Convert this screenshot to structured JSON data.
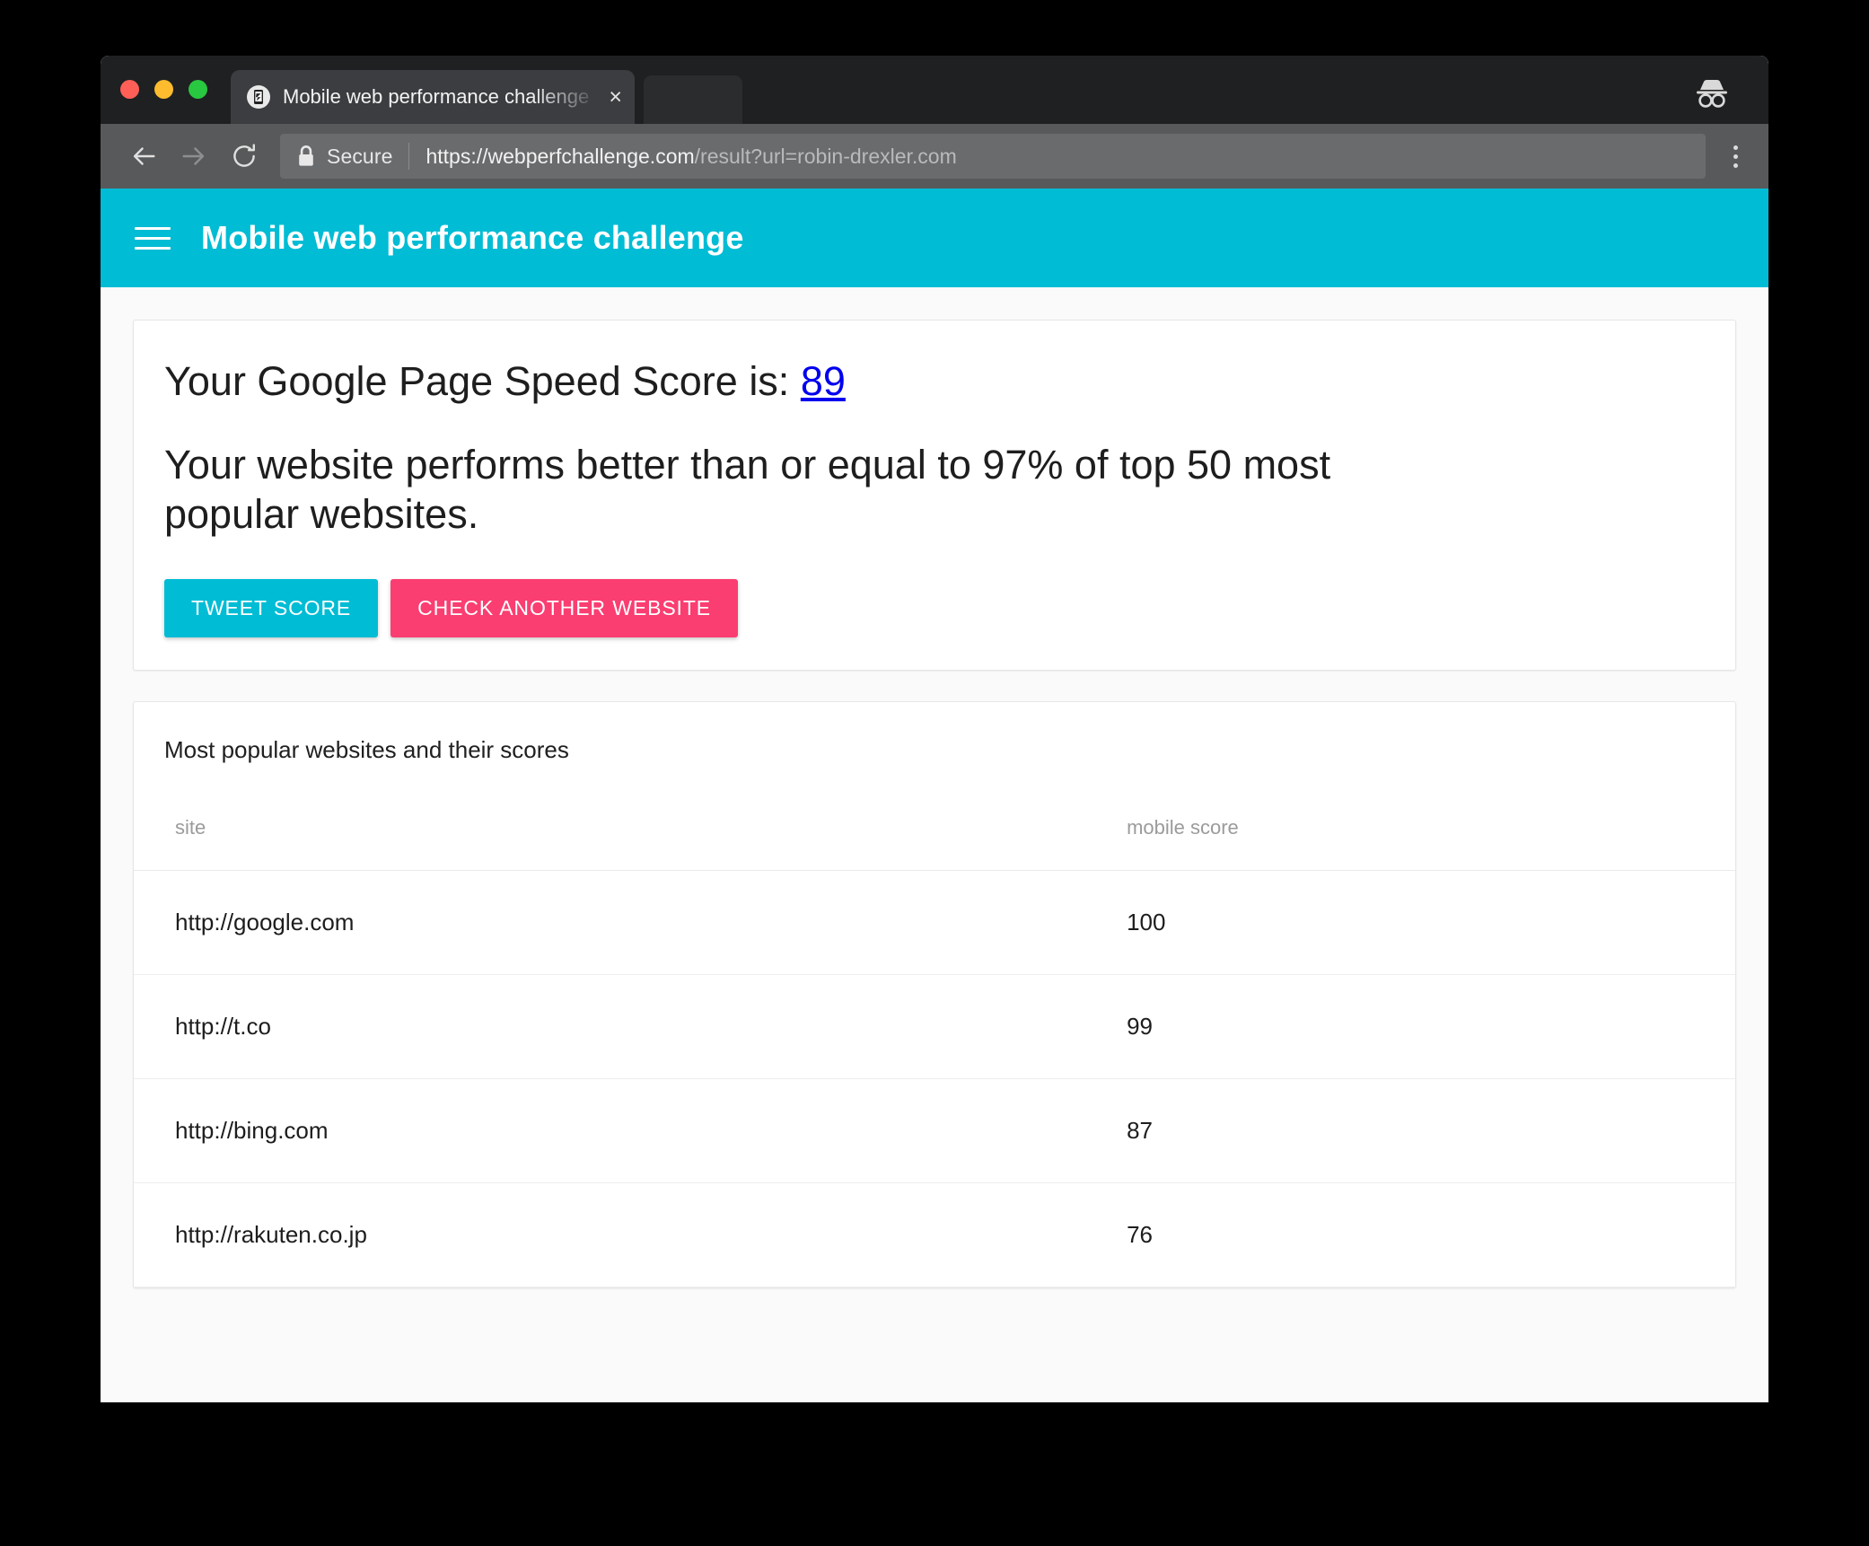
{
  "browser": {
    "tab": {
      "title": "Mobile web performance challenge",
      "close_label": "×",
      "favicon_name": "site-favicon"
    },
    "toolbar": {
      "back_label": "←",
      "forward_label": "→",
      "reload_label": "↻",
      "security_label": "Secure",
      "url_scheme_host": "https://webperfchallenge.com",
      "url_path": "/result?url=robin-drexler.com",
      "menu_label": "⋮"
    },
    "incognito_label": "incognito-icon"
  },
  "app": {
    "menu_label": "☰",
    "title": "Mobile web performance challenge",
    "accent_color": "#00bcd4"
  },
  "result": {
    "heading_prefix": "Your Google Page Speed Score is: ",
    "score": "89",
    "description": "Your website performs better than or equal to 97% of top 50 most popular websites.",
    "buttons": {
      "tweet": "TWEET SCORE",
      "check_another": "CHECK ANOTHER WEBSITE"
    },
    "button_colors": {
      "tweet": "#00bcd4",
      "check_another": "#fa3e71"
    },
    "score_link_color": "#0000ee"
  },
  "table": {
    "caption": "Most popular websites and their scores",
    "columns": [
      "site",
      "mobile score"
    ],
    "rows": [
      {
        "site": "http://google.com",
        "score": "100"
      },
      {
        "site": "http://t.co",
        "score": "99"
      },
      {
        "site": "http://bing.com",
        "score": "87"
      },
      {
        "site": "http://rakuten.co.jp",
        "score": "76"
      }
    ]
  }
}
